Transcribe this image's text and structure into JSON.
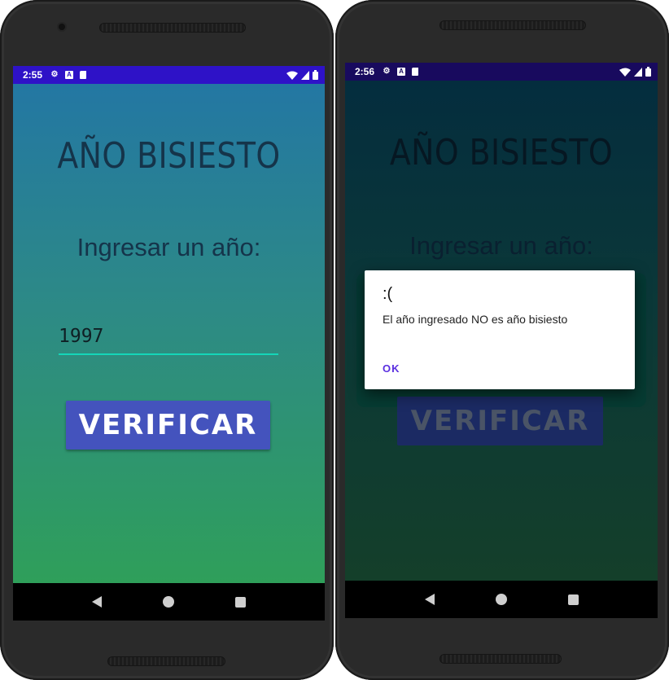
{
  "left": {
    "status": {
      "time": "2:55"
    },
    "app": {
      "title": "AÑO BISIESTO",
      "prompt": "Ingresar un año:",
      "year_input_value": "1997",
      "verify_button": "VERIFICAR"
    }
  },
  "right": {
    "status": {
      "time": "2:56"
    },
    "app": {
      "title": "AÑO BISIESTO",
      "prompt": "Ingresar un año:",
      "verify_button": "VERIFICAR"
    },
    "dialog": {
      "title": ":(",
      "message": "El año ingresado NO es año bisiesto",
      "ok_label": "OK"
    }
  },
  "colors": {
    "status_bar_left": "#2e12c7",
    "status_bar_right": "#180a5e",
    "gradient_top": "#2377a3",
    "gradient_bottom": "#2f9f5a",
    "input_underline": "#14d6b8",
    "button": "#4453bd",
    "ok_text": "#5a2fe0"
  },
  "icons": {
    "status_left": [
      "gear-icon",
      "a-icon",
      "sd-card-icon"
    ],
    "status_right": [
      "wifi-icon",
      "signal-icon",
      "battery-icon"
    ],
    "nav": [
      "back-icon",
      "home-icon",
      "recents-icon"
    ]
  }
}
